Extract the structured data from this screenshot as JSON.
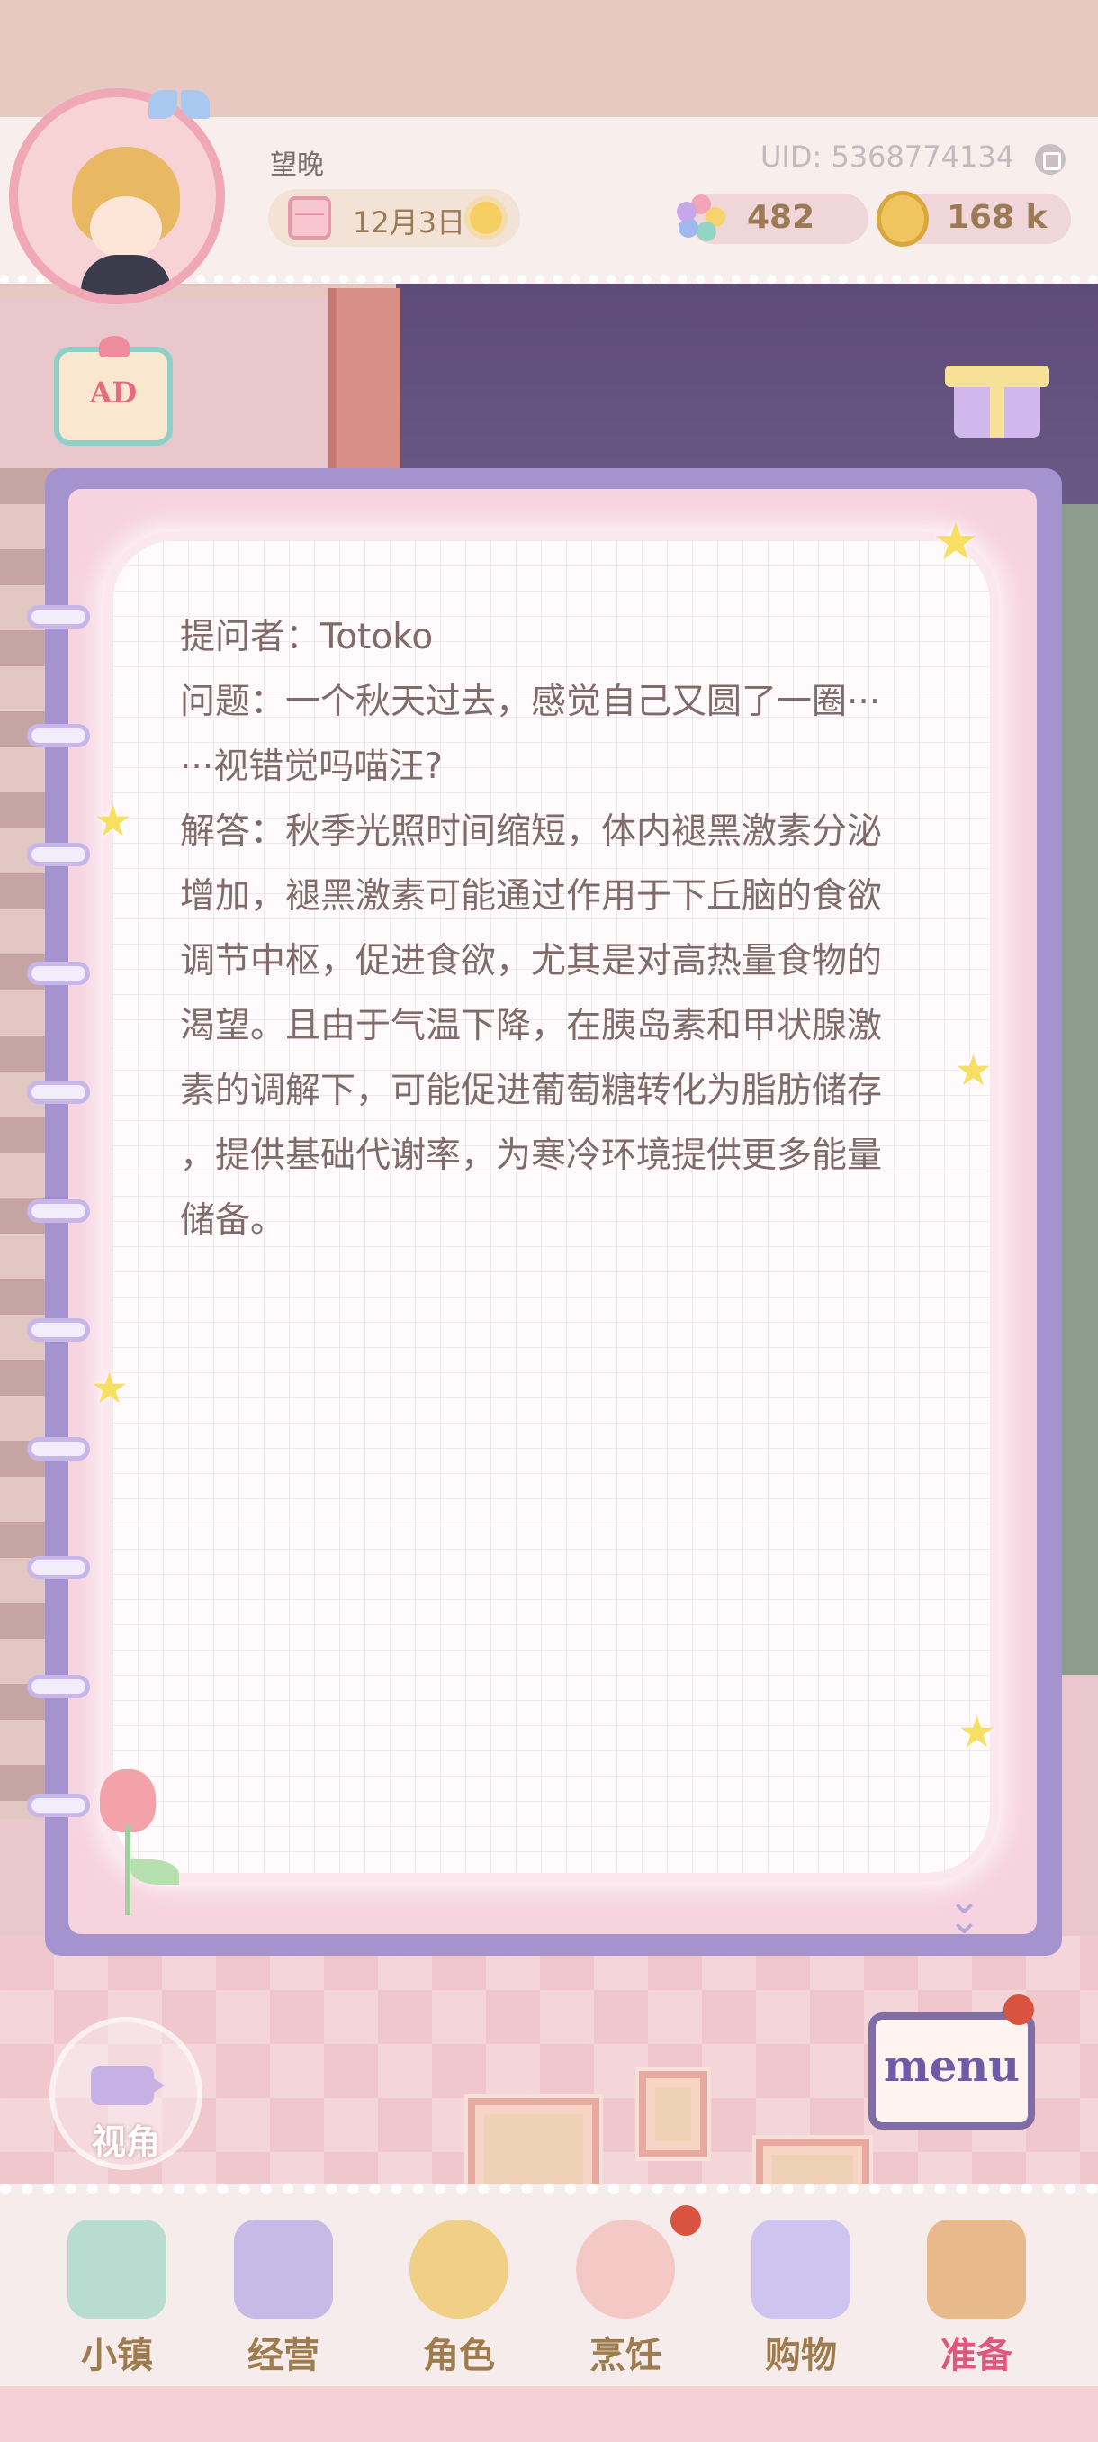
{
  "profile": {
    "username": "望晚",
    "uid": "UID: 5368774134",
    "date": "12月3日"
  },
  "currency": {
    "gems": "482",
    "coins": "168 k"
  },
  "buttons": {
    "ad_label": "AD",
    "view_label": "视角",
    "menu_label": "menu"
  },
  "note": {
    "lines": [
      "提问者：Totoko",
      "问题：一个秋天过去，感觉自己又圆了一圈···",
      "···视错觉吗喵汪?",
      "解答：秋季光照时间缩短，体内褪黑激素分泌",
      "增加，褪黑激素可能通过作用于下丘脑的食欲",
      "调节中枢，促进食欲，尤其是对高热量食物的",
      "渴望。且由于气温下降，在胰岛素和甲状腺激",
      "素的调解下，可能促进葡萄糖转化为脂肪储存",
      "，提供基础代谢率，为寒冷环境提供更多能量",
      "储备。"
    ]
  },
  "nav": {
    "items": [
      {
        "label": "小镇",
        "icon": "map-icon",
        "active": false
      },
      {
        "label": "经营",
        "icon": "briefcase-icon",
        "active": false
      },
      {
        "label": "角色",
        "icon": "character-icon",
        "active": false
      },
      {
        "label": "烹饪",
        "icon": "cooking-icon",
        "active": false,
        "badge": true
      },
      {
        "label": "购物",
        "icon": "shopping-bag-icon",
        "active": false
      },
      {
        "label": "准备",
        "icon": "basket-icon",
        "active": true
      }
    ]
  },
  "colors": {
    "notebook_border": "#a593cf",
    "page_pink": "#f7d3df",
    "text": "#806a6a",
    "nav_label": "#9e7c4d",
    "nav_active": "#e0567d",
    "badge": "#d9533f"
  }
}
